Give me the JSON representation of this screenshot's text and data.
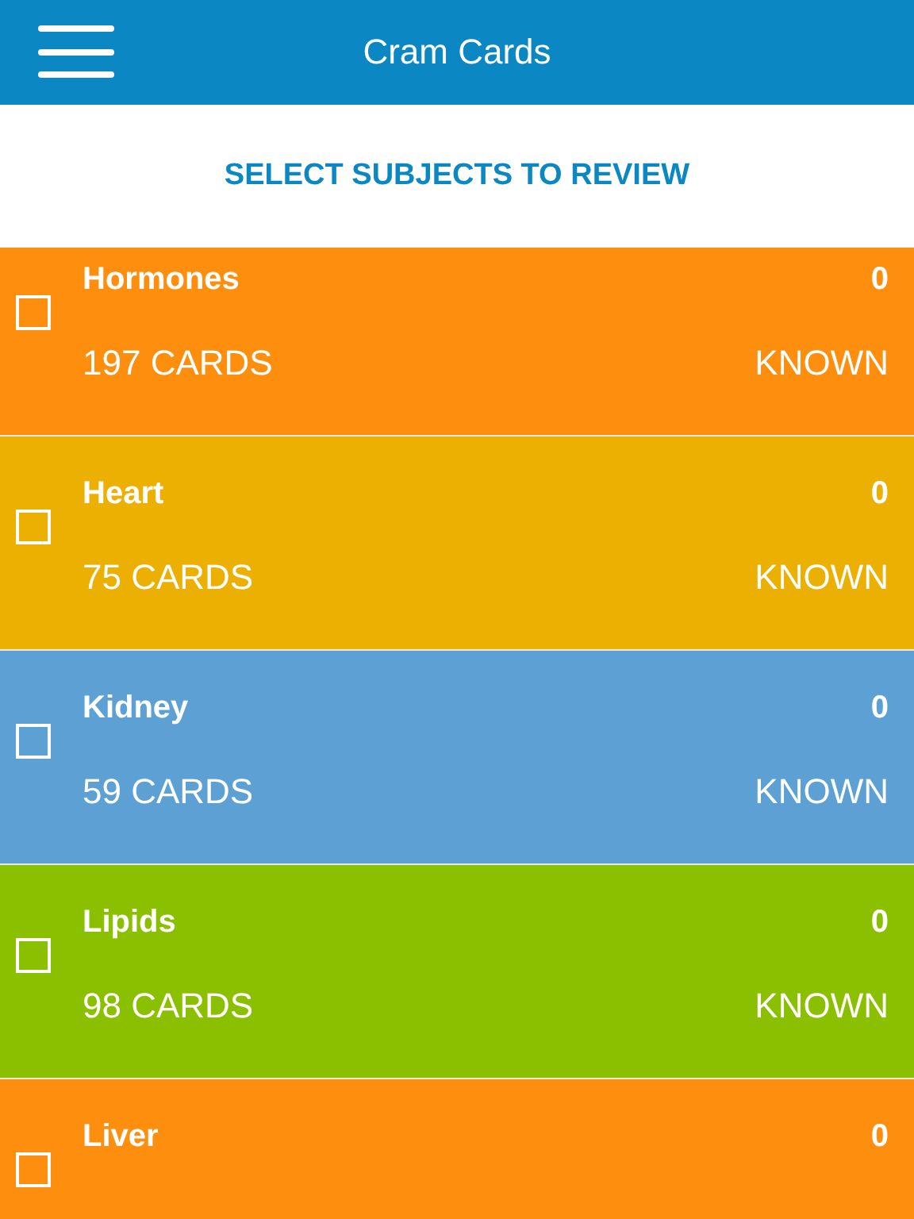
{
  "header": {
    "title": "Cram Cards"
  },
  "subheading": "SELECT SUBJECTS TO REVIEW",
  "subjects": [
    {
      "name": "Hormones",
      "known_count": "0",
      "cards": "197 CARDS",
      "known_label": "KNOWN",
      "color": "#fe8e0e",
      "checked": false
    },
    {
      "name": "Heart",
      "known_count": "0",
      "cards": "75 CARDS",
      "known_label": "KNOWN",
      "color": "#ebb002",
      "checked": false
    },
    {
      "name": "Kidney",
      "known_count": "0",
      "cards": "59 CARDS",
      "known_label": "KNOWN",
      "color": "#5ca0d4",
      "checked": false
    },
    {
      "name": "Lipids",
      "known_count": "0",
      "cards": "98 CARDS",
      "known_label": "KNOWN",
      "color": "#8bc000",
      "checked": false
    },
    {
      "name": "Liver",
      "known_count": "0",
      "color": "#fe8e0e",
      "checked": false
    }
  ]
}
